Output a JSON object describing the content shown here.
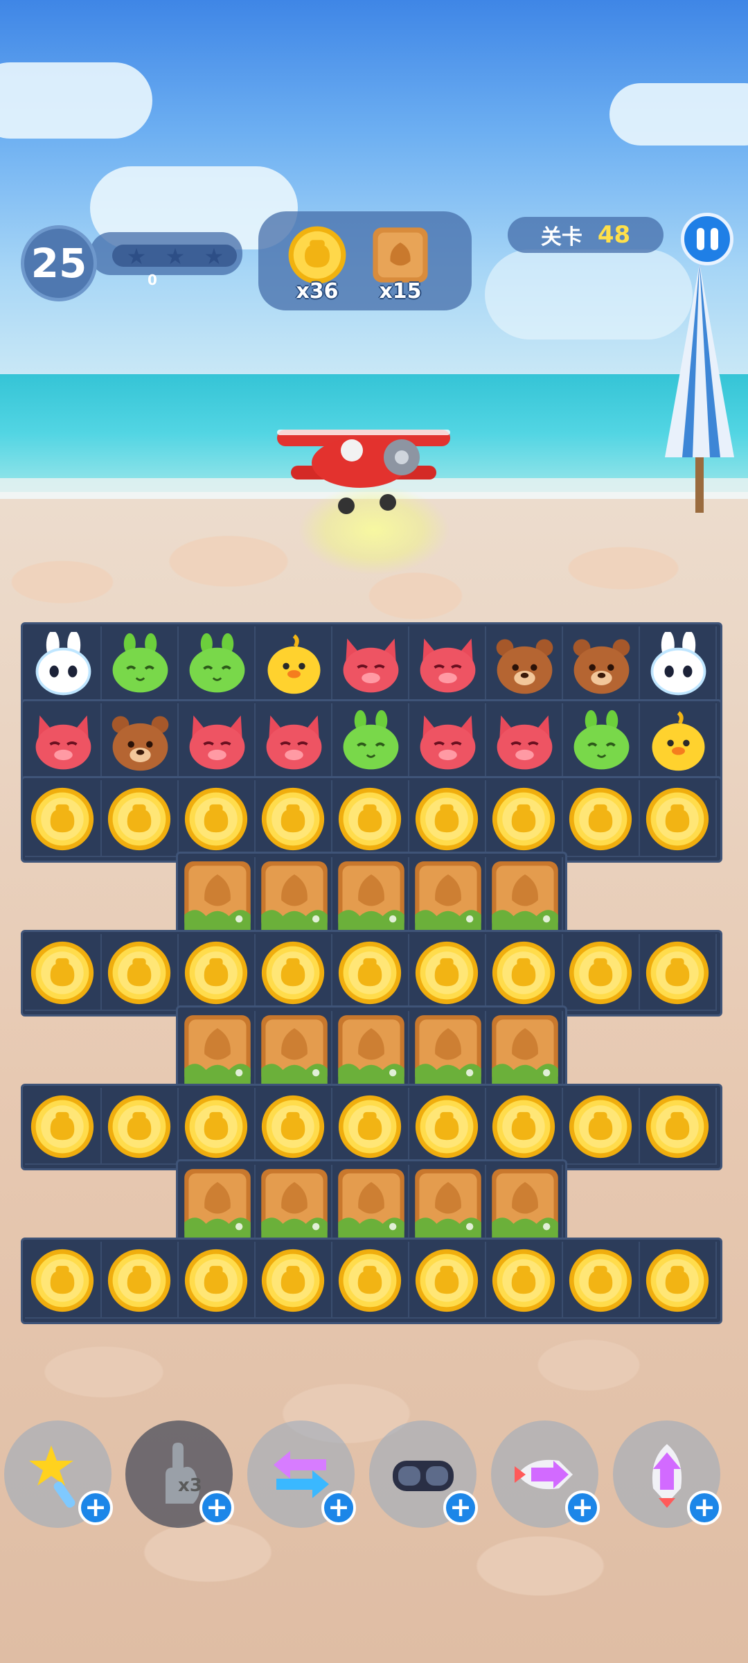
{
  "hud": {
    "moves_left": "25",
    "score": "0",
    "stars": [
      "star-1",
      "star-2",
      "star-3"
    ],
    "goals": [
      {
        "name": "gold-coin",
        "count": "x36"
      },
      {
        "name": "wooden-crate",
        "count": "x15"
      }
    ],
    "level_label": "关卡",
    "level_number": "48"
  },
  "board": {
    "rows": [
      [
        "bunny",
        "frog",
        "frog",
        "chick",
        "fox",
        "fox",
        "bear",
        "bear",
        "bunny"
      ],
      [
        "fox",
        "bear",
        "fox",
        "fox",
        "frog",
        "fox",
        "fox",
        "frog",
        "chick"
      ],
      [
        "coin",
        "coin",
        "coin",
        "coin",
        "coin",
        "coin",
        "coin",
        "coin",
        "coin"
      ],
      [
        null,
        null,
        "crate",
        "crate",
        "crate",
        "crate",
        "crate",
        null,
        null
      ],
      [
        "coin",
        "coin",
        "coin",
        "coin",
        "coin",
        "coin",
        "coin",
        "coin",
        "coin"
      ],
      [
        null,
        null,
        "crate",
        "crate",
        "crate",
        "crate",
        "crate",
        null,
        null
      ],
      [
        "coin",
        "coin",
        "coin",
        "coin",
        "coin",
        "coin",
        "coin",
        "coin",
        "coin"
      ],
      [
        null,
        null,
        "crate",
        "crate",
        "crate",
        "crate",
        "crate",
        null,
        null
      ],
      [
        "coin",
        "coin",
        "coin",
        "coin",
        "coin",
        "coin",
        "coin",
        "coin",
        "coin"
      ]
    ]
  },
  "boosters": [
    {
      "name": "magic-wand",
      "label": "+"
    },
    {
      "name": "glove-x3",
      "label": "+"
    },
    {
      "name": "swap-arrows",
      "label": "+"
    },
    {
      "name": "goggles",
      "label": "+"
    },
    {
      "name": "horizontal-rocket",
      "label": "+"
    },
    {
      "name": "vertical-rocket",
      "label": "+"
    }
  ],
  "colors": {
    "board": "#2c3c5a",
    "accent": "#1c86e8",
    "level_number": "#ffe04a"
  }
}
